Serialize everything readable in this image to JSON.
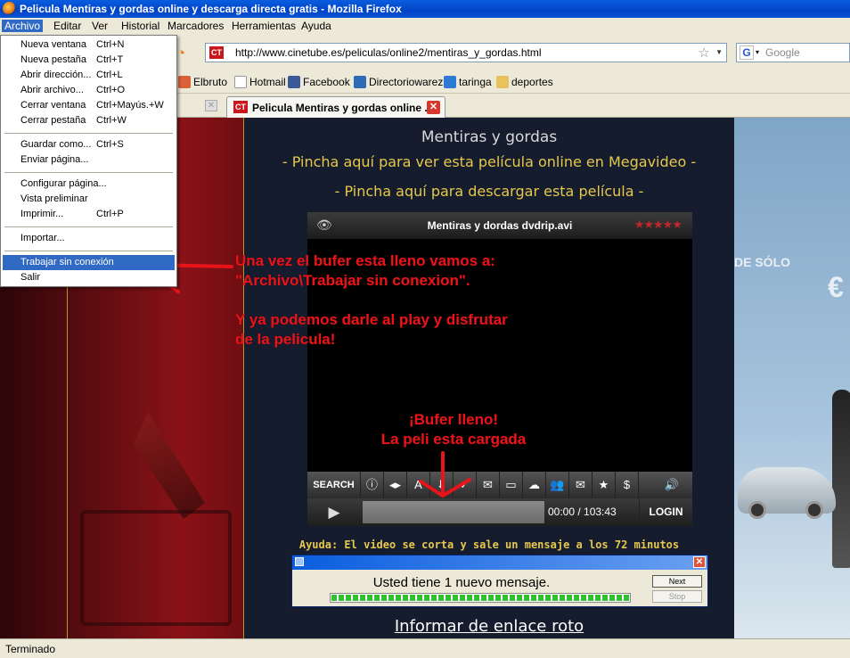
{
  "window": {
    "title": "Pelicula Mentiras y gordas online y descarga directa gratis - Mozilla Firefox"
  },
  "menubar": {
    "items": [
      {
        "label": "Archivo"
      },
      {
        "label": "Editar"
      },
      {
        "label": "Ver"
      },
      {
        "label": "Historial"
      },
      {
        "label": "Marcadores"
      },
      {
        "label": "Herramientas"
      },
      {
        "label": "Ayuda"
      }
    ]
  },
  "archivo_menu": {
    "items": [
      {
        "label": "Nueva ventana",
        "shortcut": "Ctrl+N"
      },
      {
        "label": "Nueva pestaña",
        "shortcut": "Ctrl+T"
      },
      {
        "label": "Abrir dirección...",
        "shortcut": "Ctrl+L"
      },
      {
        "label": "Abrir archivo...",
        "shortcut": "Ctrl+O"
      },
      {
        "label": "Cerrar ventana",
        "shortcut": "Ctrl+Mayús.+W"
      },
      {
        "label": "Cerrar pestaña",
        "shortcut": "Ctrl+W"
      },
      {
        "label": "Guardar como...",
        "shortcut": "Ctrl+S"
      },
      {
        "label": "Enviar página...",
        "shortcut": ""
      },
      {
        "label": "Configurar página...",
        "shortcut": ""
      },
      {
        "label": "Vista preliminar",
        "shortcut": ""
      },
      {
        "label": "Imprimir...",
        "shortcut": "Ctrl+P"
      },
      {
        "label": "Importar...",
        "shortcut": ""
      },
      {
        "label": "Trabajar sin conexión",
        "shortcut": ""
      },
      {
        "label": "Salir",
        "shortcut": ""
      }
    ]
  },
  "navbar": {
    "url": "http://www.cinetube.es/peliculas/online2/mentiras_y_gordas.html",
    "site_icon_text": "CT",
    "search_placeholder": "Google",
    "search_engine_letter": "G"
  },
  "bookmarks": [
    {
      "label": "Elbruto",
      "icon": "bookmark-icon",
      "color": "#d9623a"
    },
    {
      "label": "Hotmail",
      "icon": "page-icon",
      "color": "#ffffff"
    },
    {
      "label": "Facebook",
      "icon": "facebook-icon",
      "color": "#3b5998"
    },
    {
      "label": "Directoriowarez",
      "icon": "w-icon",
      "color": "#2d6bb5"
    },
    {
      "label": "taringa",
      "icon": "t-icon",
      "color": "#2c7ad6"
    },
    {
      "label": "deportes",
      "icon": "folder-icon",
      "color": "#e8c25a"
    }
  ],
  "tab": {
    "label": "Pelicula Mentiras y gordas online ...",
    "close": "✕"
  },
  "page": {
    "movie_title": "Mentiras y gordas",
    "link_online": "- Pincha aquí para ver esta película online en Megavideo -",
    "link_download": "- Pincha aquí para descargar esta película -",
    "help": "Ayuda: El video se corta y sale un mensaje a los 72 minutos",
    "broken_link": "Informar de enlace roto",
    "ad_text": "DE SÓLO",
    "ad_euro": "€"
  },
  "player": {
    "title": "Mentiras y dordas dvdrip.avi",
    "stars": "★★★★★",
    "search_label": "SEARCH",
    "time": "00:00 / 103:43",
    "login_label": "LOGIN",
    "progress": 0
  },
  "popup": {
    "message": "Usted tiene 1 nuevo mensaje.",
    "next_label": "Next",
    "stop_label": "Stop",
    "progress": 1.0
  },
  "annotations": {
    "line1": "Una vez el bufer esta lleno vamos a:",
    "line2": "\"Archivo\\Trabajar sin conexion\".",
    "line3": "Y ya podemos darle al play y disfrutar",
    "line4": "de la pelicula!",
    "buffer1": "¡Bufer lleno!",
    "buffer2": "La peli esta cargada"
  },
  "status": {
    "text": "Terminado"
  },
  "colors": {
    "annotation": "#e8141a",
    "link": "#e6c84b",
    "accent": "#316ac5"
  }
}
